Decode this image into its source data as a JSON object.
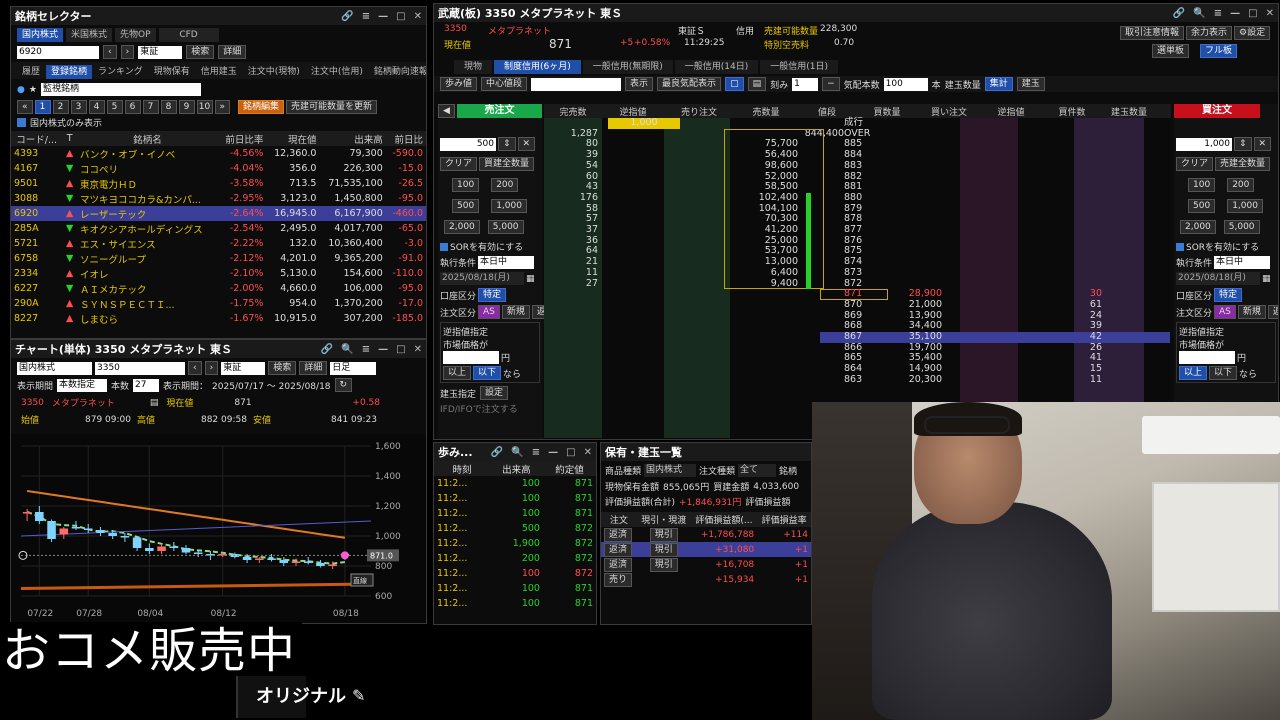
{
  "selector": {
    "title": "銘柄セレクター",
    "market_tabs": [
      "国内株式",
      "米国株式",
      "先物OP",
      "CFD"
    ],
    "code_value": "6920",
    "exchange": "東証",
    "search": "検索",
    "detail": "詳細",
    "tabs": [
      "履歴",
      "登録銘柄",
      "ランキング",
      "現物保有",
      "信用建玉",
      "注文中(現物)",
      "注文中(信用)",
      "銘柄動向速報"
    ],
    "watchlist_name": "監視銘柄",
    "pages": [
      "1",
      "2",
      "3",
      "4",
      "5",
      "6",
      "7",
      "8",
      "9",
      "10"
    ],
    "edit_button": "銘柄編集",
    "update_button": "売建可能数量を更新",
    "domestic_only": "国内株式のみ表示",
    "columns": [
      "コード/...",
      "T",
      "銘柄名",
      "前日比率",
      "現在値",
      "出来高",
      "前日比"
    ],
    "rows": [
      {
        "code": "4393",
        "name": "バンク・オブ・イノベ",
        "ratio": "-4.56%",
        "price": "12,360.0",
        "volume": "79,300",
        "change": "-590.0",
        "dir": "up"
      },
      {
        "code": "4167",
        "name": "ココペリ",
        "ratio": "-4.04%",
        "price": "356.0",
        "volume": "226,300",
        "change": "-15.0",
        "dir": "down"
      },
      {
        "code": "9501",
        "name": "東京電力ＨＤ",
        "ratio": "-3.58%",
        "price": "713.5",
        "volume": "71,535,100",
        "change": "-26.5",
        "dir": "up"
      },
      {
        "code": "3088",
        "name": "マツキヨココカラ&カンパ...",
        "ratio": "-2.95%",
        "price": "3,123.0",
        "volume": "1,450,800",
        "change": "-95.0",
        "dir": "down"
      },
      {
        "code": "6920",
        "name": "レーザーテック",
        "ratio": "-2.64%",
        "price": "16,945.0",
        "volume": "6,167,900",
        "change": "-460.0",
        "dir": "up"
      },
      {
        "code": "285A",
        "name": "キオクシアホールディングス",
        "ratio": "-2.54%",
        "price": "2,495.0",
        "volume": "4,017,700",
        "change": "-65.0",
        "dir": "down"
      },
      {
        "code": "5721",
        "name": "エス・サイエンス",
        "ratio": "-2.22%",
        "price": "132.0",
        "volume": "10,360,400",
        "change": "-3.0",
        "dir": "up"
      },
      {
        "code": "6758",
        "name": "ソニーグループ",
        "ratio": "-2.12%",
        "price": "4,201.0",
        "volume": "9,365,200",
        "change": "-91.0",
        "dir": "down"
      },
      {
        "code": "2334",
        "name": "イオレ",
        "ratio": "-2.10%",
        "price": "5,130.0",
        "volume": "154,600",
        "change": "-110.0",
        "dir": "up"
      },
      {
        "code": "6227",
        "name": "ＡＩメカテック",
        "ratio": "-2.00%",
        "price": "4,660.0",
        "volume": "106,000",
        "change": "-95.0",
        "dir": "down"
      },
      {
        "code": "290A",
        "name": "ＳＹＮＳＰＥＣＴＩ...",
        "ratio": "-1.75%",
        "price": "954.0",
        "volume": "1,370,200",
        "change": "-17.0",
        "dir": "up"
      },
      {
        "code": "8227",
        "name": "しまむら",
        "ratio": "-1.67%",
        "price": "10,915.0",
        "volume": "307,200",
        "change": "-185.0",
        "dir": "up"
      }
    ]
  },
  "chart": {
    "title": "チャート(単体) 3350 メタプラネット 東Ｓ",
    "market": "国内株式",
    "code": "3350",
    "exchange": "東証",
    "search": "検索",
    "detail": "詳細",
    "period": "日足",
    "disp_label": "表示期間",
    "disp_mode": "本数指定",
    "count_label": "本数",
    "count": "27",
    "range_label": "表示期間：",
    "range": "2025/07/17 〜 2025/08/18",
    "stock_code": "3350",
    "stock_name": "メタプラネット",
    "current_label": "現在値",
    "current": "871",
    "change": "+0.58",
    "open_label": "始値",
    "open": "879 09:00",
    "high_label": "高値",
    "high": "882 09:58",
    "low_label": "安値",
    "low": "841 09:23",
    "price_tag": "871.0",
    "chart_data": {
      "type": "candlestick",
      "ylim": [
        600,
        1600
      ],
      "y_ticks": [
        "1,600",
        "1,400",
        "1,200",
        "1,000",
        "800",
        "600"
      ],
      "x_ticks": [
        "07/22",
        "07/28",
        "08/04",
        "08/12",
        "08/18"
      ],
      "candles": [
        [
          1150,
          1180,
          1100,
          1160
        ],
        [
          1160,
          1200,
          1080,
          1100
        ],
        [
          1100,
          1110,
          960,
          980
        ],
        [
          1010,
          1060,
          980,
          1050
        ],
        [
          1060,
          1100,
          1040,
          1050
        ],
        [
          1050,
          1080,
          1020,
          1040
        ],
        [
          1040,
          1060,
          1000,
          1020
        ],
        [
          1020,
          1040,
          980,
          1000
        ],
        [
          1000,
          1020,
          960,
          990
        ],
        [
          990,
          1000,
          900,
          920
        ],
        [
          920,
          950,
          880,
          900
        ],
        [
          900,
          940,
          880,
          930
        ],
        [
          930,
          960,
          900,
          920
        ],
        [
          920,
          940,
          880,
          890
        ],
        [
          890,
          910,
          860,
          880
        ],
        [
          880,
          900,
          840,
          870
        ],
        [
          870,
          890,
          860,
          880
        ],
        [
          880,
          890,
          850,
          860
        ],
        [
          860,
          880,
          820,
          840
        ],
        [
          840,
          860,
          820,
          850
        ],
        [
          850,
          880,
          830,
          840
        ],
        [
          840,
          860,
          800,
          820
        ],
        [
          820,
          850,
          800,
          830
        ],
        [
          830,
          860,
          810,
          820
        ],
        [
          820,
          840,
          790,
          800
        ],
        [
          800,
          830,
          780,
          810
        ],
        [
          879,
          882,
          841,
          871
        ]
      ]
    },
    "line_label": "直線"
  },
  "board": {
    "title": "武蔵(板) 3350 メタプラネット 東Ｓ",
    "code": "3350",
    "name": "メタプラネット",
    "current_label": "現在値",
    "price": "871",
    "change": "+5",
    "ratio": "+0.58%",
    "time": "11:29:25",
    "market": "東証Ｓ",
    "margin": "信用",
    "sell_avail_label": "売建可能数量",
    "sell_avail": "228,300",
    "special_label": "特別空売料",
    "special": "0.70",
    "top_buttons": [
      "取引注意情報",
      "余力表示",
      "設定",
      "選単板",
      "フル板"
    ],
    "tabs": [
      "現物",
      "制度信用(6ヶ月)",
      "一般信用(無期限)",
      "一般信用(14日)",
      "一般信用(1日)"
    ],
    "toolbar": {
      "ayumi": "歩み値",
      "center": "中心値段",
      "show": "表示",
      "best": "最良気配表示",
      "tick": "刻み",
      "tick_val": "1",
      "kehai_label": "気配本数",
      "kehai_val": "100",
      "hon": "本",
      "tate": "建玉数量",
      "shukei": "集計",
      "tateb": "建玉"
    },
    "headers": [
      "売注文",
      "完売数",
      "逆指値",
      "売り注文",
      "売数量",
      "値段",
      "買数量",
      "買い注文",
      "逆指値",
      "買件数",
      "建玉数量",
      "買注文"
    ],
    "sell_header_qty": "1,000",
    "market_row": "成行",
    "over_row": {
      "count": "1,287",
      "qty": "844,400",
      "price": "OVER"
    },
    "asks": [
      {
        "c": "80",
        "q": "75,700",
        "p": "885"
      },
      {
        "c": "39",
        "q": "56,400",
        "p": "884"
      },
      {
        "c": "54",
        "q": "98,600",
        "p": "883"
      },
      {
        "c": "60",
        "q": "52,000",
        "p": "882"
      },
      {
        "c": "43",
        "q": "58,500",
        "p": "881"
      },
      {
        "c": "176",
        "q": "102,400",
        "p": "880"
      },
      {
        "c": "58",
        "q": "104,100",
        "p": "879"
      },
      {
        "c": "57",
        "q": "70,300",
        "p": "878"
      },
      {
        "c": "37",
        "q": "41,200",
        "p": "877"
      },
      {
        "c": "36",
        "q": "25,000",
        "p": "876"
      },
      {
        "c": "64",
        "q": "53,700",
        "p": "875"
      },
      {
        "c": "21",
        "q": "13,000",
        "p": "874"
      },
      {
        "c": "11",
        "q": "6,400",
        "p": "873"
      },
      {
        "c": "27",
        "q": "9,400",
        "p": "872"
      }
    ],
    "bids": [
      {
        "p": "871",
        "q": "28,900",
        "c": "30",
        "hl": "red"
      },
      {
        "p": "870",
        "q": "21,000",
        "c": "61"
      },
      {
        "p": "869",
        "q": "13,900",
        "c": "24"
      },
      {
        "p": "868",
        "q": "34,400",
        "c": "39"
      },
      {
        "p": "867",
        "q": "35,100",
        "c": "42",
        "hl": "sel"
      },
      {
        "p": "866",
        "q": "19,700",
        "c": "26"
      },
      {
        "p": "865",
        "q": "35,400",
        "c": "41"
      },
      {
        "p": "864",
        "q": "14,900",
        "c": "15"
      },
      {
        "p": "863",
        "q": "20,300",
        "c": "11"
      }
    ],
    "sell_panel": {
      "title": "売注文",
      "qty": "500",
      "clear": "クリア",
      "sell_all": "買建全数量",
      "btn100": "100",
      "btn200": "200",
      "btn500": "500",
      "btn1000": "1,000",
      "btn2000": "2,000",
      "btn5000": "5,000",
      "sor": "SORを有効にする",
      "cond_label": "執行条件",
      "cond": "本日中",
      "date": "2025/08/18(月)",
      "acct_label": "口座区分",
      "acct": "特定",
      "ord_label": "注文区分",
      "as": "AS",
      "new": "新規",
      "close": "返済",
      "stop_label": "逆指値指定",
      "mkt_label": "市場価格が",
      "yen": "円",
      "above": "以上",
      "below": "以下",
      "nara": "なら",
      "tate_label": "建玉指定",
      "setting": "設定",
      "ifd": "IFD/IFOで注文する"
    },
    "buy_panel": {
      "title": "買注文",
      "qty": "1,000",
      "clear": "クリア",
      "sell_all": "売建全数量",
      "btn100": "100",
      "btn200": "200",
      "btn500": "500",
      "btn1000": "1,000",
      "btn2000": "2,000",
      "btn5000": "5,000",
      "sor": "SORを有効にする",
      "cond_label": "執行条件",
      "cond": "本日中",
      "date": "2025/08/18(月)",
      "acct_label": "口座区分",
      "acct": "特定",
      "ord_label": "注文区分",
      "as": "AS",
      "new": "新規",
      "close": "返済",
      "stop_label": "逆指値指定",
      "mkt_label": "市場価格が",
      "yen": "円",
      "above": "以上",
      "below": "以下",
      "nara": "なら"
    }
  },
  "ayumi": {
    "title": "歩み...",
    "headers": [
      "時刻",
      "出来高",
      "約定値"
    ],
    "rows": [
      {
        "t": "11:2...",
        "v": "100",
        "p": "871",
        "c": "green"
      },
      {
        "t": "11:2...",
        "v": "100",
        "p": "871",
        "c": "green"
      },
      {
        "t": "11:2...",
        "v": "100",
        "p": "871",
        "c": "green"
      },
      {
        "t": "11:2...",
        "v": "500",
        "p": "872",
        "c": "green"
      },
      {
        "t": "11:2...",
        "v": "1,900",
        "p": "872",
        "c": "green"
      },
      {
        "t": "11:2...",
        "v": "200",
        "p": "872",
        "c": "green"
      },
      {
        "t": "11:2...",
        "v": "100",
        "p": "872",
        "c": "red"
      },
      {
        "t": "11:2...",
        "v": "100",
        "p": "871",
        "c": "green"
      },
      {
        "t": "11:2...",
        "v": "100",
        "p": "871",
        "c": "green"
      }
    ]
  },
  "holdings": {
    "title": "保有・建玉一覧",
    "prod_label": "商品種類",
    "prod": "国内株式",
    "ord_label": "注文種類",
    "ord": "全て",
    "meig": "銘柄",
    "spot_label": "現物保有金額",
    "spot": "855,065円",
    "buy_label": "買建金額",
    "buy": "4,033,600",
    "pl_label": "評価損益額(合計)",
    "pl": "+1,846,931円",
    "pl2_label": "評価損益額",
    "headers": [
      "注文",
      "現引・現渡",
      "評価損益額(...",
      "評価損益率"
    ],
    "rows": [
      {
        "a": "返済",
        "b": "現引",
        "pl": "+1,786,788",
        "pr": "+114"
      },
      {
        "a": "返済",
        "b": "現引",
        "pl": "+31,080",
        "pr": "+1"
      },
      {
        "a": "返済",
        "b": "現引",
        "pl": "+16,708",
        "pr": "+1"
      },
      {
        "a": "売り",
        "b": "",
        "pl": "+15,934",
        "pr": "+1"
      }
    ]
  },
  "overlay": {
    "banner": "おコメ販売中",
    "original": "オリジナル"
  }
}
